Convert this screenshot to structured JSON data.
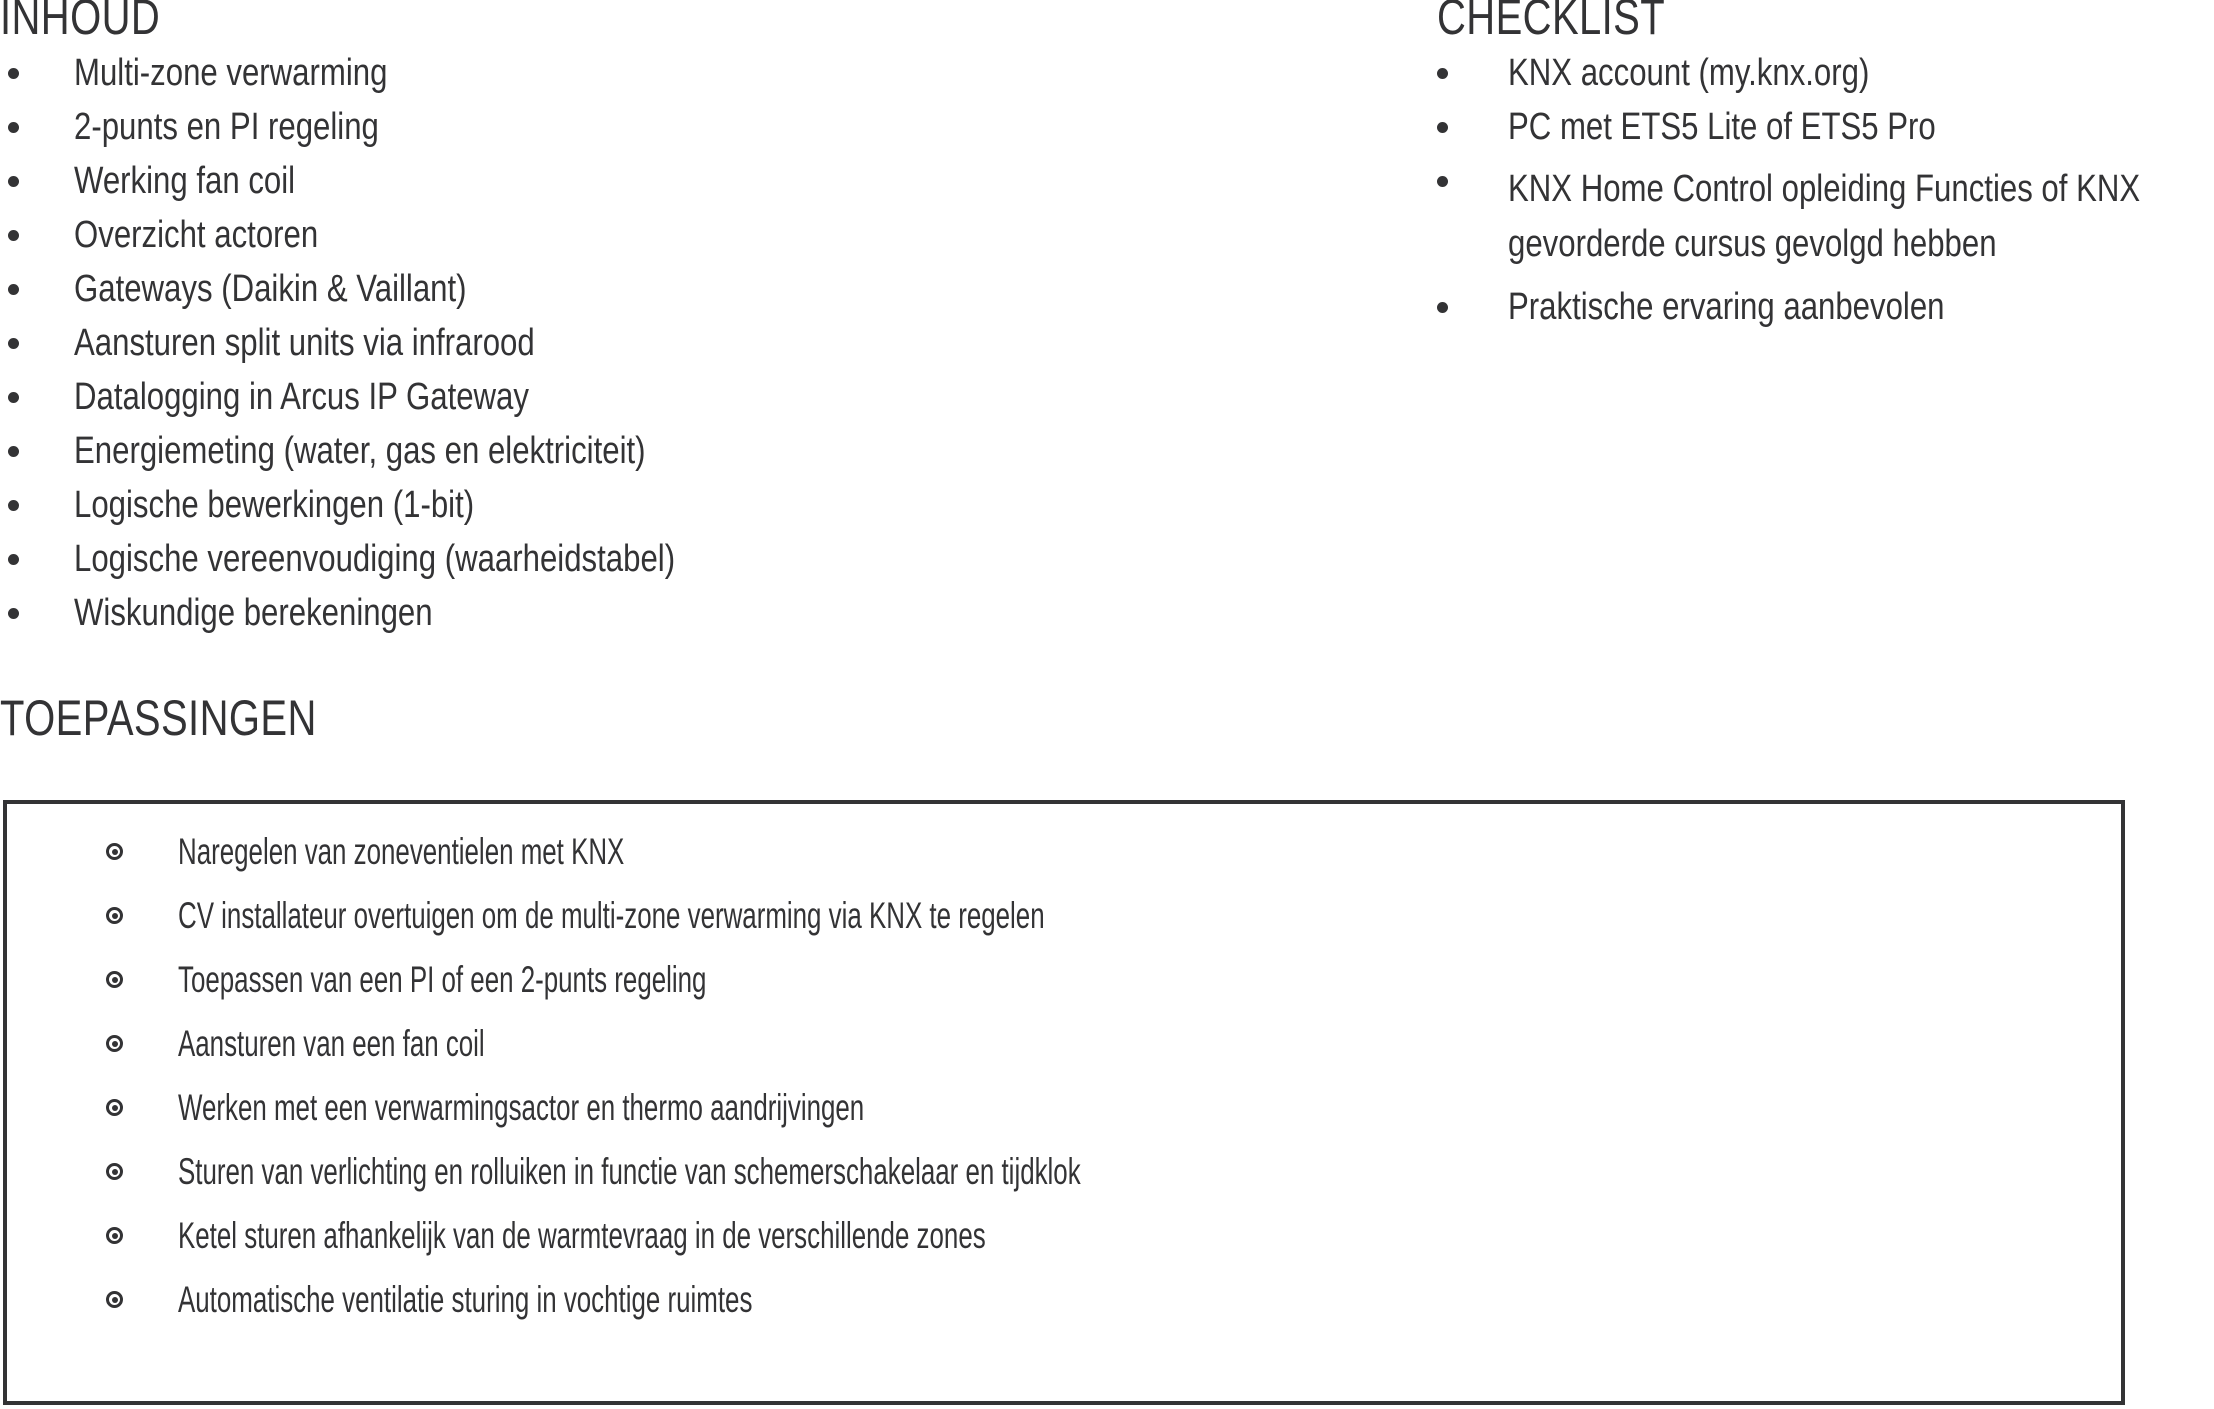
{
  "sections": {
    "inhoud": {
      "heading": "INHOUD",
      "items": [
        "Multi-zone verwarming",
        "2-punts en PI regeling",
        "Werking fan coil",
        "Overzicht actoren",
        "Gateways (Daikin & Vaillant)",
        "Aansturen split units via infrarood",
        "Datalogging in Arcus IP Gateway",
        "Energiemeting (water, gas en elektriciteit)",
        "Logische bewerkingen (1-bit)",
        "Logische vereenvoudiging (waarheidstabel)",
        "Wiskundige berekeningen"
      ]
    },
    "checklist": {
      "heading": "CHECKLIST",
      "items": [
        "KNX account (my.knx.org)",
        "PC met ETS5 Lite of ETS5 Pro",
        "KNX Home Control opleiding Functies of KNX gevorderde cursus gevolgd hebben",
        "Praktische ervaring aanbevolen"
      ]
    },
    "toepassingen": {
      "heading": "TOEPASSINGEN",
      "items": [
        "Naregelen van zoneventielen met KNX",
        "CV installateur overtuigen om de multi-zone verwarming via KNX te regelen",
        "Toepassen van een PI of een 2-punts regeling",
        "Aansturen van een fan coil",
        "Werken met een verwarmingsactor en thermo aandrijvingen",
        "Sturen van verlichting en rolluiken in functie van schemerschakelaar en tijdklok",
        "Ketel sturen afhankelijk van de warmtevraag in de verschillende zones",
        "Automatische ventilatie sturing in vochtige ruimtes"
      ]
    }
  },
  "style": {
    "text_color": "#333335",
    "box_border_color": "#333335",
    "background": "#ffffff"
  }
}
